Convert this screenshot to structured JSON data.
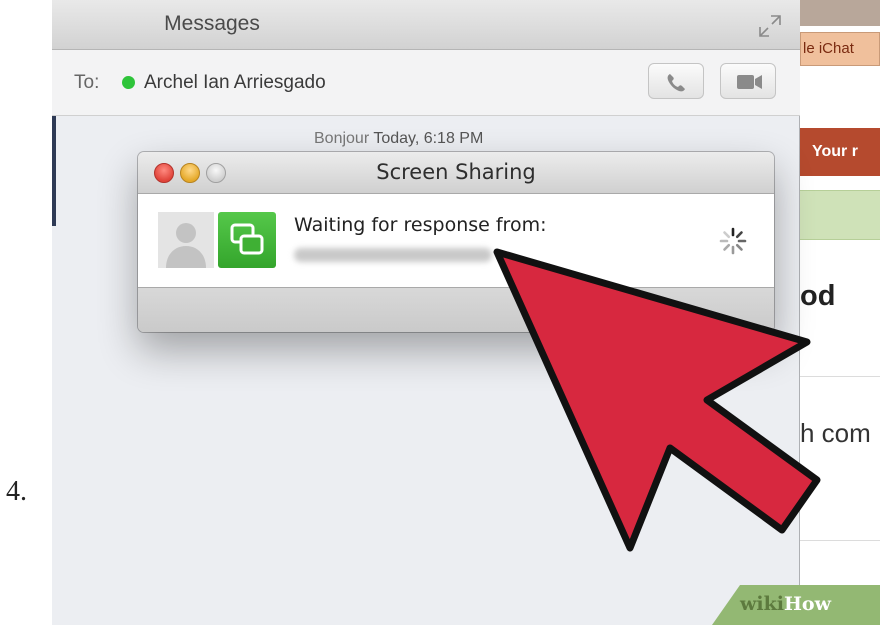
{
  "step_number": "4.",
  "messages_window": {
    "title": "Messages",
    "to_label": "To:",
    "contact_name": "Archel Ian Arriesgado",
    "contact_status": "online",
    "timestamp_prefix": "Bonjour",
    "timestamp_value": "Today, 6:18 PM"
  },
  "screen_sharing_dialog": {
    "title": "Screen Sharing",
    "waiting_text": "Waiting for response from:"
  },
  "background_page": {
    "tab_text": "le iChat",
    "banner_text": "Your r",
    "heading_fragment": "od",
    "body_fragment": "h com"
  },
  "watermark": {
    "wiki": "wiki",
    "how": "How"
  },
  "colors": {
    "presence": "#2ec43a",
    "arrow": "#d7283f",
    "screen_sharing_icon": "#3fb034",
    "banner": "#b54a2e",
    "watermark": "#93b873"
  }
}
